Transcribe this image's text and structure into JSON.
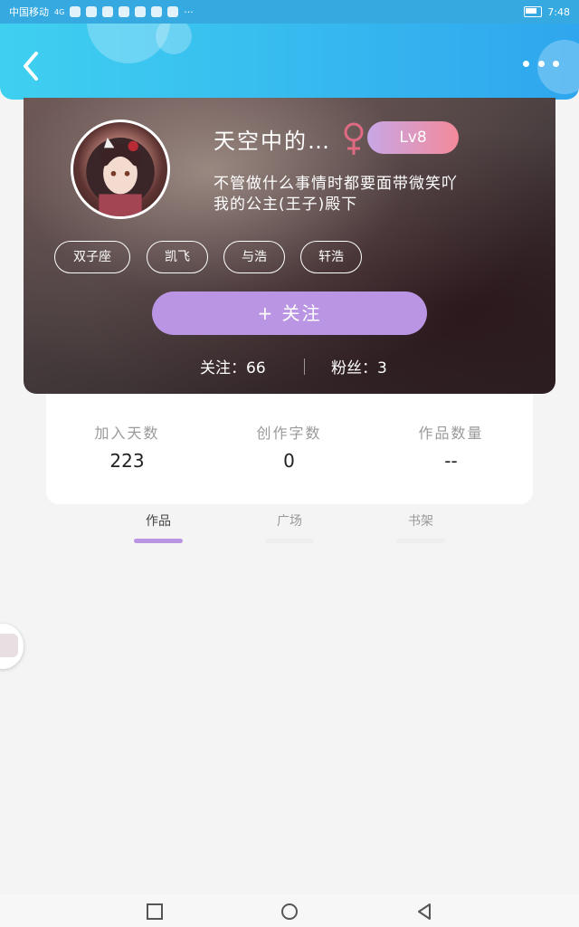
{
  "status_bar": {
    "carrier": "中国移动",
    "network": "4G",
    "time": "7:48"
  },
  "header": {
    "back_icon": "chevron-left-icon",
    "more_icon": "more-dots-icon",
    "gradient": [
      "#3fd0f0",
      "#2fa6ee"
    ]
  },
  "profile": {
    "username": "天空中的…",
    "gender_icon": "female-icon",
    "level": "Lv8",
    "bio_line1": "不管做什么事情时都要面带微笑吖",
    "bio_line2": "我的公主(王子)殿下",
    "tags": [
      "双子座",
      "凯飞",
      "与浩",
      "轩浩"
    ],
    "follow_button": "+   关注",
    "following_text": "关注：66",
    "fans_text": "粉丝：3"
  },
  "info": {
    "days_label": "加入天数",
    "days_value": "223",
    "words_label": "创作字数",
    "words_value": "0",
    "works_label": "作品数量",
    "works_value": "--"
  },
  "tabs": [
    {
      "label": "作品",
      "active": true
    },
    {
      "label": "广场",
      "active": false
    },
    {
      "label": "书架",
      "active": false
    }
  ],
  "colors": {
    "accent": "#b995e4",
    "level_gradient": [
      "#c8a7e6",
      "#f38a9a"
    ],
    "female": "#e06a82"
  }
}
